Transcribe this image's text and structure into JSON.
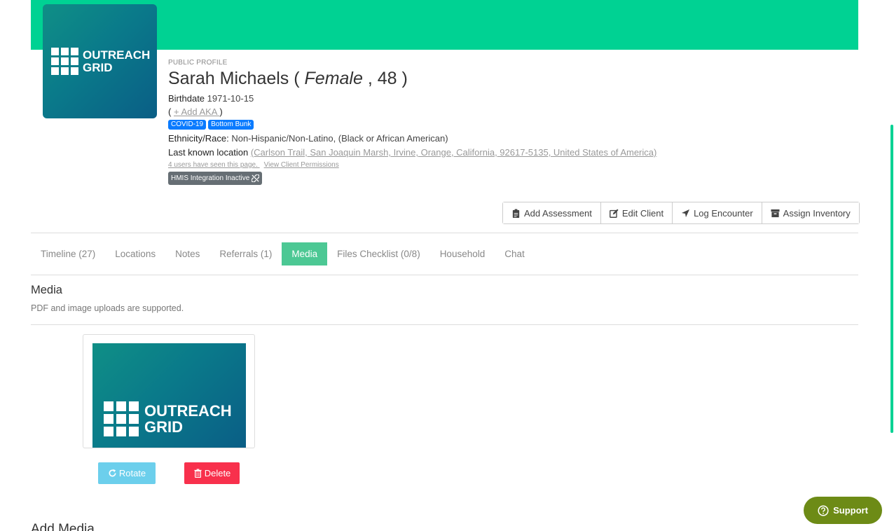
{
  "brand": {
    "logo_line1": "OUTREACH",
    "logo_line2": "GRID",
    "banner_color": "#00d293"
  },
  "profile": {
    "kicker": "PUBLIC PROFILE",
    "name": "Sarah Michaels",
    "name_open": " ( ",
    "gender": "Female",
    "age_sep": " , ",
    "age": "48",
    "name_close": " )",
    "birthdate_label": "Birthdate",
    "birthdate": "1971-10-15",
    "aka_open": "( ",
    "aka_link": "+ Add AKA ",
    "aka_close": ")",
    "tags": [
      "COVID-19",
      "Bottom Bunk"
    ],
    "ethnicity_label": "Ethnicity/Race:",
    "ethnicity": "Non-Hispanic/Non-Latino, (Black or African American)",
    "location_label": "Last known location",
    "location": "(Carlson Trail, San Joaquin Marsh, Irvine, Orange, California, 92617-5135, United States of America)",
    "seen_text": "4 users have seen this page. ",
    "permissions_link": "View Client Permissions",
    "hmis_badge": "HMIS Integration Inactive"
  },
  "actions": {
    "add_assessment": "Add Assessment",
    "edit_client": "Edit Client",
    "log_encounter": "Log Encounter",
    "assign_inventory": "Assign Inventory"
  },
  "tabs": [
    {
      "label": "Timeline (27)",
      "active": false
    },
    {
      "label": "Locations",
      "active": false
    },
    {
      "label": "Notes",
      "active": false
    },
    {
      "label": "Referrals (1)",
      "active": false
    },
    {
      "label": "Media",
      "active": true
    },
    {
      "label": "Files Checklist (0/8)",
      "active": false
    },
    {
      "label": "Household",
      "active": false
    },
    {
      "label": "Chat",
      "active": false
    }
  ],
  "media": {
    "title": "Media",
    "subtitle": "PDF and image uploads are supported.",
    "rotate_label": "Rotate",
    "delete_label": "Delete",
    "add_title": "Add Media"
  },
  "support": {
    "label": "Support"
  }
}
